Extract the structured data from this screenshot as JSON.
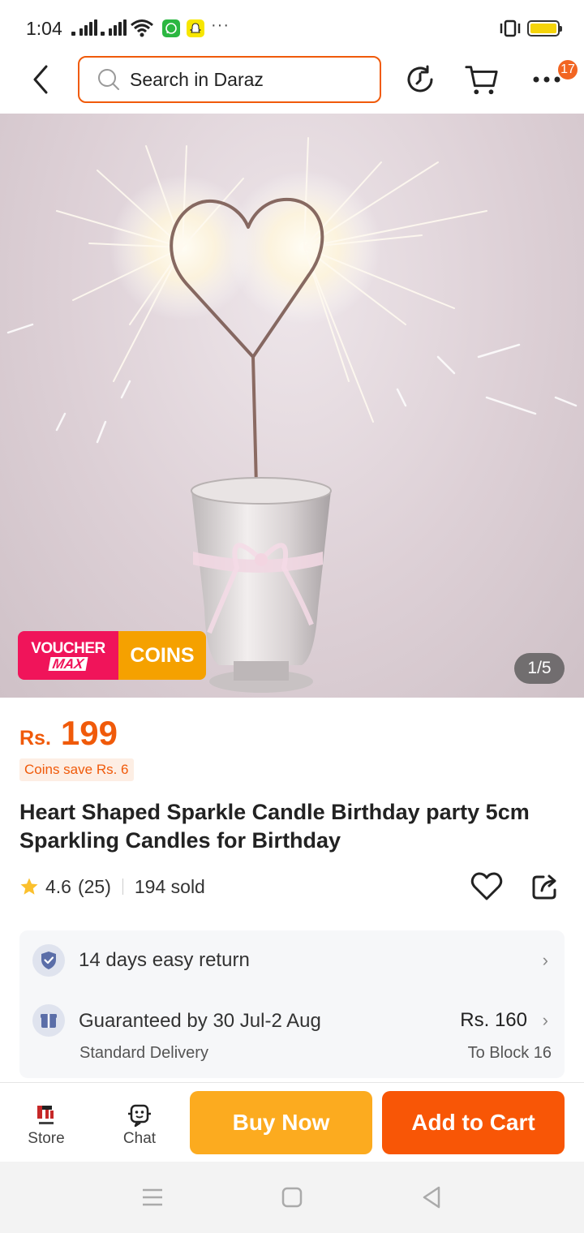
{
  "status_bar": {
    "time": "1:04",
    "more_indicator": "···",
    "icons": [
      "signal-icon",
      "signal-icon",
      "wifi-icon",
      "whatsapp-icon",
      "snapchat-icon",
      "vibrate-icon",
      "battery-icon"
    ],
    "battery_color": "#f5d40a"
  },
  "header": {
    "search_placeholder": "Search in Daraz",
    "cart_badge": "17",
    "accent_color": "#f05a0a"
  },
  "gallery": {
    "counter": "1/5",
    "voucher_label_top": "VOUCHER",
    "voucher_label_bottom": "MAX",
    "coins_label": "COINS"
  },
  "product": {
    "currency": "Rs.",
    "price": "199",
    "coins_save": "Coins save Rs. 6",
    "title": "Heart Shaped  Sparkle  Candle Birthday party 5cm Sparkling Candles for Birthday",
    "rating": "4.6",
    "review_count": "(25)",
    "sold": "194 sold"
  },
  "delivery": {
    "return_policy": "14 days easy return",
    "guarantee": "Guaranteed by 30 Jul-2 Aug",
    "delivery_type": "Standard Delivery",
    "fee": "Rs. 160",
    "destination": "To Block 16"
  },
  "actions": {
    "store_label": "Store",
    "chat_label": "Chat",
    "buy_now": "Buy Now",
    "add_to_cart": "Add to Cart",
    "buy_color": "#fcab1f",
    "cart_color": "#f85606"
  }
}
